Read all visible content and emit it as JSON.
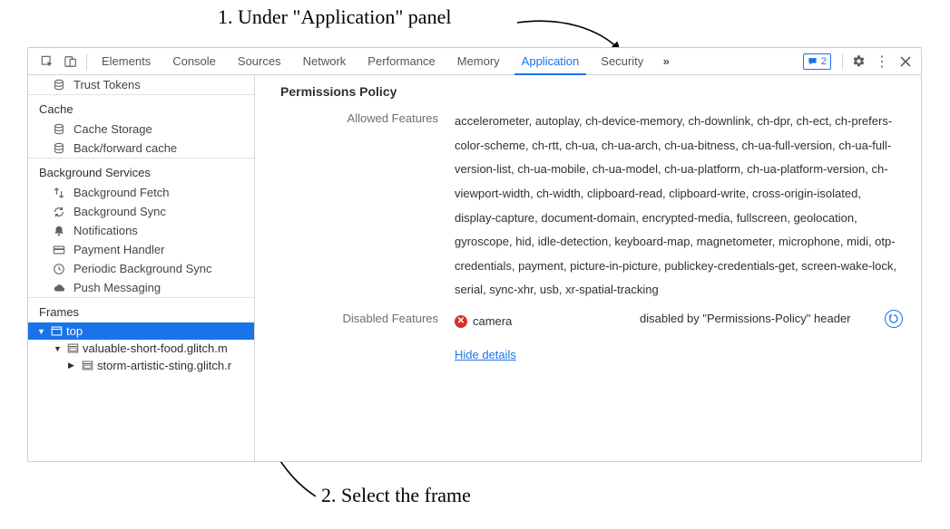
{
  "annotations": {
    "step1": "1. Under \"Application\" panel",
    "step2": "2. Select the frame"
  },
  "tabs": {
    "items": [
      "Elements",
      "Console",
      "Sources",
      "Network",
      "Performance",
      "Memory",
      "Application",
      "Security"
    ],
    "active": "Application",
    "message_count": "2"
  },
  "sidebar": {
    "trust_tokens": "Trust Tokens",
    "cache_header": "Cache",
    "cache_storage": "Cache Storage",
    "bf_cache": "Back/forward cache",
    "bg_header": "Background Services",
    "bg_fetch": "Background Fetch",
    "bg_sync": "Background Sync",
    "notifications": "Notifications",
    "payment_handler": "Payment Handler",
    "periodic_sync": "Periodic Background Sync",
    "push": "Push Messaging",
    "frames_header": "Frames",
    "frame_top": "top",
    "frame_child1": "valuable-short-food.glitch.m",
    "frame_child2": "storm-artistic-sting.glitch.r"
  },
  "main": {
    "title": "Permissions Policy",
    "allowed_label": "Allowed Features",
    "allowed_value": "accelerometer, autoplay, ch-device-memory, ch-downlink, ch-dpr, ch-ect, ch-prefers-color-scheme, ch-rtt, ch-ua, ch-ua-arch, ch-ua-bitness, ch-ua-full-version, ch-ua-full-version-list, ch-ua-mobile, ch-ua-model, ch-ua-platform, ch-ua-platform-version, ch-viewport-width, ch-width, clipboard-read, clipboard-write, cross-origin-isolated, display-capture, document-domain, encrypted-media, fullscreen, geolocation, gyroscope, hid, idle-detection, keyboard-map, magnetometer, microphone, midi, otp-credentials, payment, picture-in-picture, publickey-credentials-get, screen-wake-lock, serial, sync-xhr, usb, xr-spatial-tracking",
    "disabled_label": "Disabled Features",
    "disabled_feature": "camera",
    "disabled_reason": "disabled by \"Permissions-Policy\" header",
    "hide_details": "Hide details"
  }
}
